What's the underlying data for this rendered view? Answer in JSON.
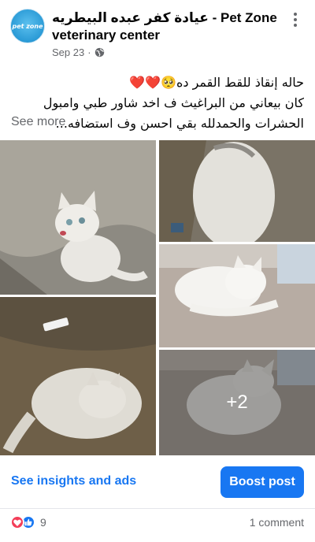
{
  "post": {
    "page_name": "عيادة كفر عبده البيطريه - Pet Zone veterinary center",
    "date": "Sep 23",
    "separator": "·",
    "avatar_label": "pet zone",
    "text_lines": [
      "حاله إنقاذ للقط القمر ده🥺❤️❤️",
      "كان بيعاني من البراغيث ف اخد شاور طبي وامبول",
      "الحشرات والحمدلله بقي احسن وف استضافه..."
    ],
    "see_more": "See more",
    "extra_photos": "+2"
  },
  "actions": {
    "insights": "See insights and ads",
    "boost": "Boost post"
  },
  "stats": {
    "reaction_count": "9",
    "comments": "1 comment"
  },
  "colors": {
    "accent": "#1877f2",
    "muted": "#65676b",
    "love": "#f33e58"
  }
}
